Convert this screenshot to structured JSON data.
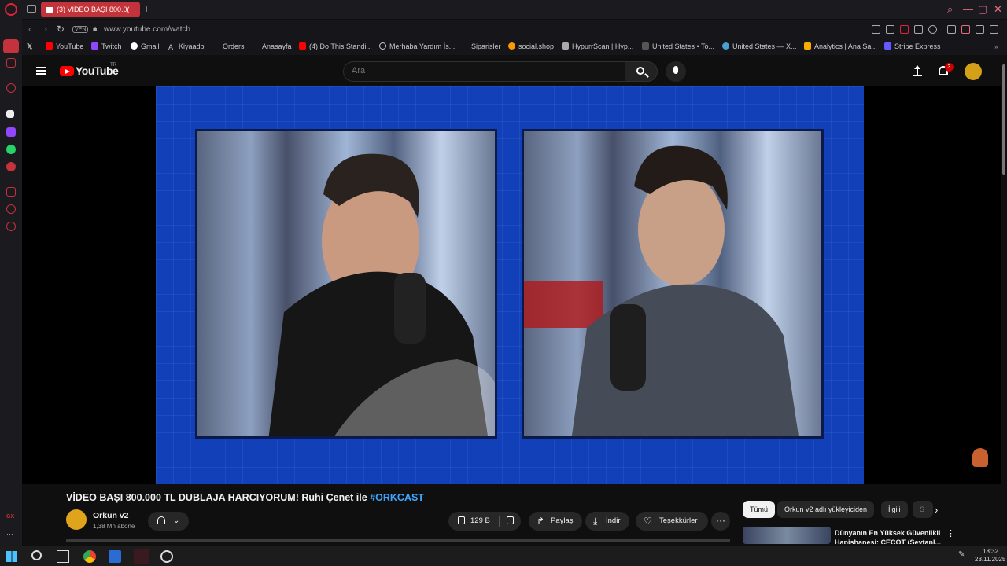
{
  "browser": {
    "active_tab_title": "(3) VİDEO BAŞI 800.0(",
    "address": "www.youtube.com/watch",
    "vpn_label": "VPN",
    "bookmarks": [
      {
        "label": "YouTube",
        "color": "#ff0000"
      },
      {
        "label": "Twitch",
        "color": "#9146ff"
      },
      {
        "label": "Gmail",
        "color": "#ffffff"
      },
      {
        "label": "Kiyaadb",
        "color": "#cccccc"
      },
      {
        "label": "Orders",
        "color": "#888888"
      },
      {
        "label": "Anasayfa",
        "color": "#555555"
      },
      {
        "label": "(4) Do This Standi...",
        "color": "#ff0000"
      },
      {
        "label": "Merhaba Yardım İs...",
        "color": "#cccccc"
      },
      {
        "label": "Siparisler",
        "color": "#666666"
      },
      {
        "label": "social.shop",
        "color": "#ff9900"
      },
      {
        "label": "HypurrScan | Hyp...",
        "color": "#cccccc"
      },
      {
        "label": "United States • To...",
        "color": "#777777"
      },
      {
        "label": "United States — X...",
        "color": "#4aa0d0"
      },
      {
        "label": "Analytics | Ana Sa...",
        "color": "#f9ab00"
      },
      {
        "label": "Stripe Express",
        "color": "#635bff"
      }
    ]
  },
  "youtube": {
    "logo_text": "YouTube",
    "logo_country": "TR",
    "search_placeholder": "Ara",
    "notification_count": "3"
  },
  "video": {
    "title": "VİDEO BAŞI 800.000 TL DUBLAJA HARCIYORUM! Ruhi Çenet ile ",
    "hashtag": "#ORKCAST",
    "channel_name": "Orkun v2",
    "channel_subs": "1,38 Mn abone",
    "like_count": "129 B",
    "share_label": "Paylaş",
    "download_label": "İndir",
    "thanks_label": "Teşekkürler",
    "more_label": "···"
  },
  "chips": {
    "all": "Tümü",
    "from_channel": "Orkun v2 adlı yükleyiciden",
    "related": "İlgili",
    "partial": "S"
  },
  "recommended": {
    "title": "Dünyanın En Yüksek Güvenlikli Hapishanesi: CECOT (Şeytanl..."
  },
  "taskbar": {
    "time": "18:32",
    "date": "23.11.2025"
  },
  "colors": {
    "accent_red": "#ff0000",
    "link_blue": "#3ea6ff",
    "video_bg": "#1240b8"
  }
}
